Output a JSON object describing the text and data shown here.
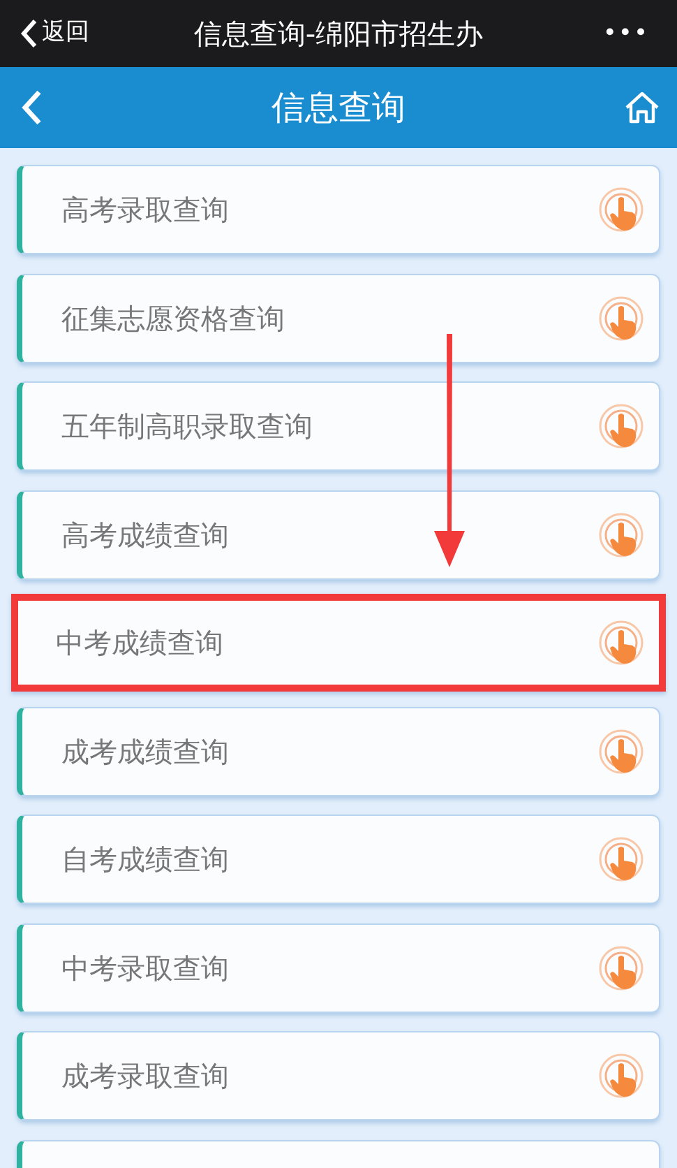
{
  "top_bar": {
    "back": "返回",
    "title": "信息查询-绵阳市招生办",
    "more": "•••"
  },
  "header": {
    "title": "信息查询"
  },
  "items": [
    {
      "label": "高考录取查询",
      "highlighted": false
    },
    {
      "label": "征集志愿资格查询",
      "highlighted": false
    },
    {
      "label": "五年制高职录取查询",
      "highlighted": false
    },
    {
      "label": "高考成绩查询",
      "highlighted": false
    },
    {
      "label": "中考成绩查询",
      "highlighted": true
    },
    {
      "label": "成考成绩查询",
      "highlighted": false
    },
    {
      "label": "自考成绩查询",
      "highlighted": false
    },
    {
      "label": "中考录取查询",
      "highlighted": false
    },
    {
      "label": "成考录取查询",
      "highlighted": false
    }
  ],
  "more_below": true
}
